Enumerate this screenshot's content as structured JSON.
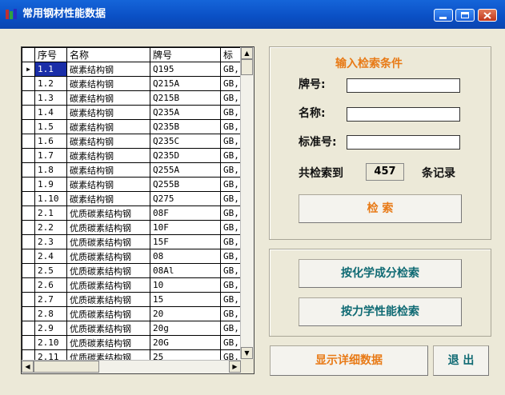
{
  "window": {
    "title": "常用钢材性能数据"
  },
  "grid": {
    "columns": [
      "序号",
      "名称",
      "牌号",
      "标"
    ],
    "rows": [
      [
        "1.1",
        "碳素结构钢",
        "Q195",
        "GB,"
      ],
      [
        "1.2",
        "碳素结构钢",
        "Q215A",
        "GB,"
      ],
      [
        "1.3",
        "碳素结构钢",
        "Q215B",
        "GB,"
      ],
      [
        "1.4",
        "碳素结构钢",
        "Q235A",
        "GB,"
      ],
      [
        "1.5",
        "碳素结构钢",
        "Q235B",
        "GB,"
      ],
      [
        "1.6",
        "碳素结构钢",
        "Q235C",
        "GB,"
      ],
      [
        "1.7",
        "碳素结构钢",
        "Q235D",
        "GB,"
      ],
      [
        "1.8",
        "碳素结构钢",
        "Q255A",
        "GB,"
      ],
      [
        "1.9",
        "碳素结构钢",
        "Q255B",
        "GB,"
      ],
      [
        "1.10",
        "碳素结构钢",
        "Q275",
        "GB,"
      ],
      [
        "2.1",
        "优质碳素结构钢",
        "08F",
        "GB,"
      ],
      [
        "2.2",
        "优质碳素结构钢",
        "10F",
        "GB,"
      ],
      [
        "2.3",
        "优质碳素结构钢",
        "15F",
        "GB,"
      ],
      [
        "2.4",
        "优质碳素结构钢",
        "08",
        "GB,"
      ],
      [
        "2.5",
        "优质碳素结构钢",
        "08Al",
        "GB,"
      ],
      [
        "2.6",
        "优质碳素结构钢",
        "10",
        "GB,"
      ],
      [
        "2.7",
        "优质碳素结构钢",
        "15",
        "GB,"
      ],
      [
        "2.8",
        "优质碳素结构钢",
        "20",
        "GB,"
      ],
      [
        "2.9",
        "优质碳素结构钢",
        "20g",
        "GB,"
      ],
      [
        "2.10",
        "优质碳素结构钢",
        "20G",
        "GB,"
      ],
      [
        "2.11",
        "优质碳素结构钢",
        "25",
        "GB,"
      ]
    ],
    "current_row_marker": "▶"
  },
  "search": {
    "title": "输入检索条件",
    "grade_label": "牌号:",
    "grade_value": "",
    "name_label": "名称:",
    "name_value": "",
    "standard_label": "标准号:",
    "standard_value": "",
    "found_prefix": "共检索到",
    "found_count": "457",
    "found_suffix": "条记录",
    "search_button": "检 索"
  },
  "buttons": {
    "chem_search": "按化学成分检索",
    "mech_search": "按力学性能检索",
    "show_detail": "显示详细数据",
    "exit": "退 出"
  },
  "colors": {
    "title_bar": "#0a4fc4",
    "accent_orange": "#e87a16",
    "accent_teal": "#0f6a73",
    "selection": "#1a2ea8"
  }
}
